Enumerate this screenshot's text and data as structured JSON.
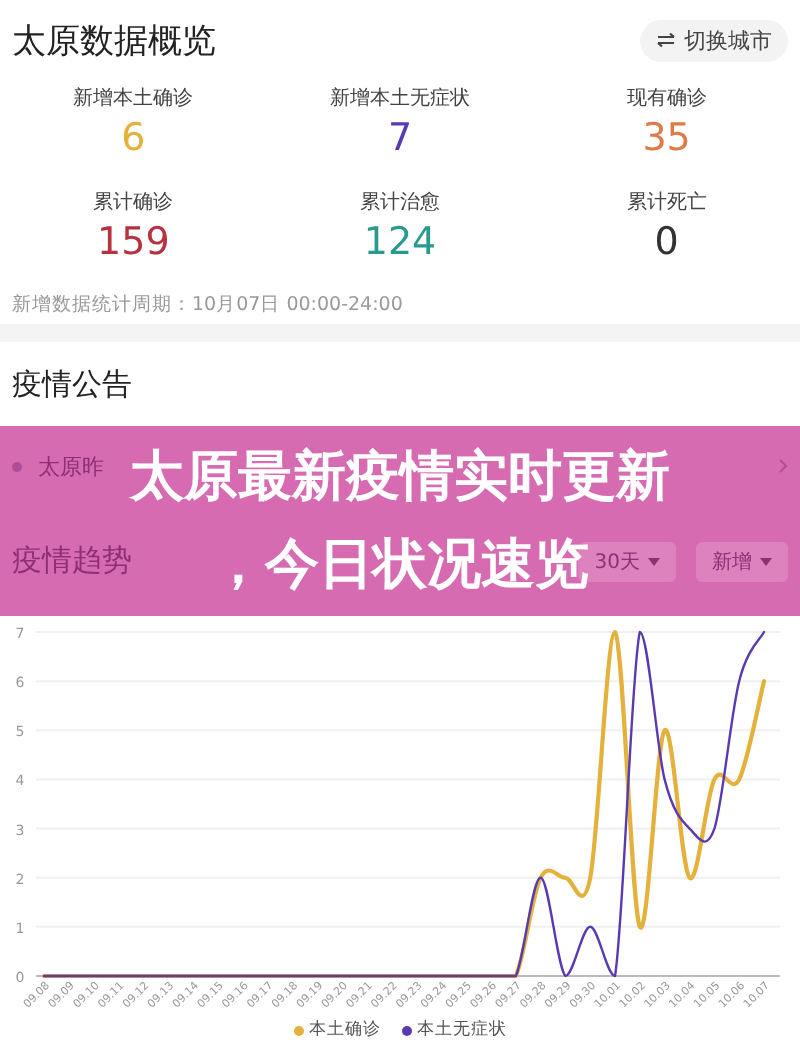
{
  "overview": {
    "title": "太原数据概览",
    "switch_button": "切换城市",
    "stats": [
      {
        "label": "新增本土确诊",
        "value": "6",
        "color": "#e3b13c"
      },
      {
        "label": "新增本土无症状",
        "value": "7",
        "color": "#5a3ab0"
      },
      {
        "label": "现有确诊",
        "value": "35",
        "color": "#e07a48"
      },
      {
        "label": "累计确诊",
        "value": "159",
        "color": "#b5323f"
      },
      {
        "label": "累计治愈",
        "value": "124",
        "color": "#2a9a8e"
      },
      {
        "label": "累计死亡",
        "value": "0",
        "color": "#333333"
      }
    ],
    "period_note": "新增数据统计周期：10月07日 00:00-24:00"
  },
  "notices": {
    "title": "疫情公告",
    "items": [
      "太原昨"
    ]
  },
  "banner": {
    "lines": [
      "太原最新疫情实时更新",
      "，今日状况速览"
    ]
  },
  "trend": {
    "title": "疫情趋势",
    "filters": [
      "30天",
      "新增"
    ],
    "chart_data": {
      "type": "line",
      "grid": true,
      "x": [
        "09.08",
        "09.09",
        "09.10",
        "09.11",
        "09.12",
        "09.13",
        "09.14",
        "09.15",
        "09.16",
        "09.17",
        "09.18",
        "09.19",
        "09.20",
        "09.21",
        "09.22",
        "09.23",
        "09.24",
        "09.25",
        "09.26",
        "09.27",
        "09.28",
        "09.29",
        "09.30",
        "10.01",
        "10.02",
        "10.03",
        "10.04",
        "10.05",
        "10.06",
        "10.07"
      ],
      "ylim": [
        0,
        7
      ],
      "yticks": [
        0,
        1,
        2,
        3,
        4,
        5,
        6,
        7
      ],
      "series": [
        {
          "name": "本土确诊",
          "color": "#e3b13c",
          "values": [
            0,
            0,
            0,
            0,
            0,
            0,
            0,
            0,
            0,
            0,
            0,
            0,
            0,
            0,
            0,
            0,
            0,
            0,
            0,
            0,
            2,
            2,
            2,
            7,
            1,
            5,
            2,
            4,
            4,
            6
          ]
        },
        {
          "name": "本土无症状",
          "color": "#5a3ab0",
          "values": [
            0,
            0,
            0,
            0,
            0,
            0,
            0,
            0,
            0,
            0,
            0,
            0,
            0,
            0,
            0,
            0,
            0,
            0,
            0,
            0,
            2,
            0,
            1,
            0,
            7,
            4,
            3,
            3,
            6,
            7
          ]
        }
      ]
    }
  }
}
